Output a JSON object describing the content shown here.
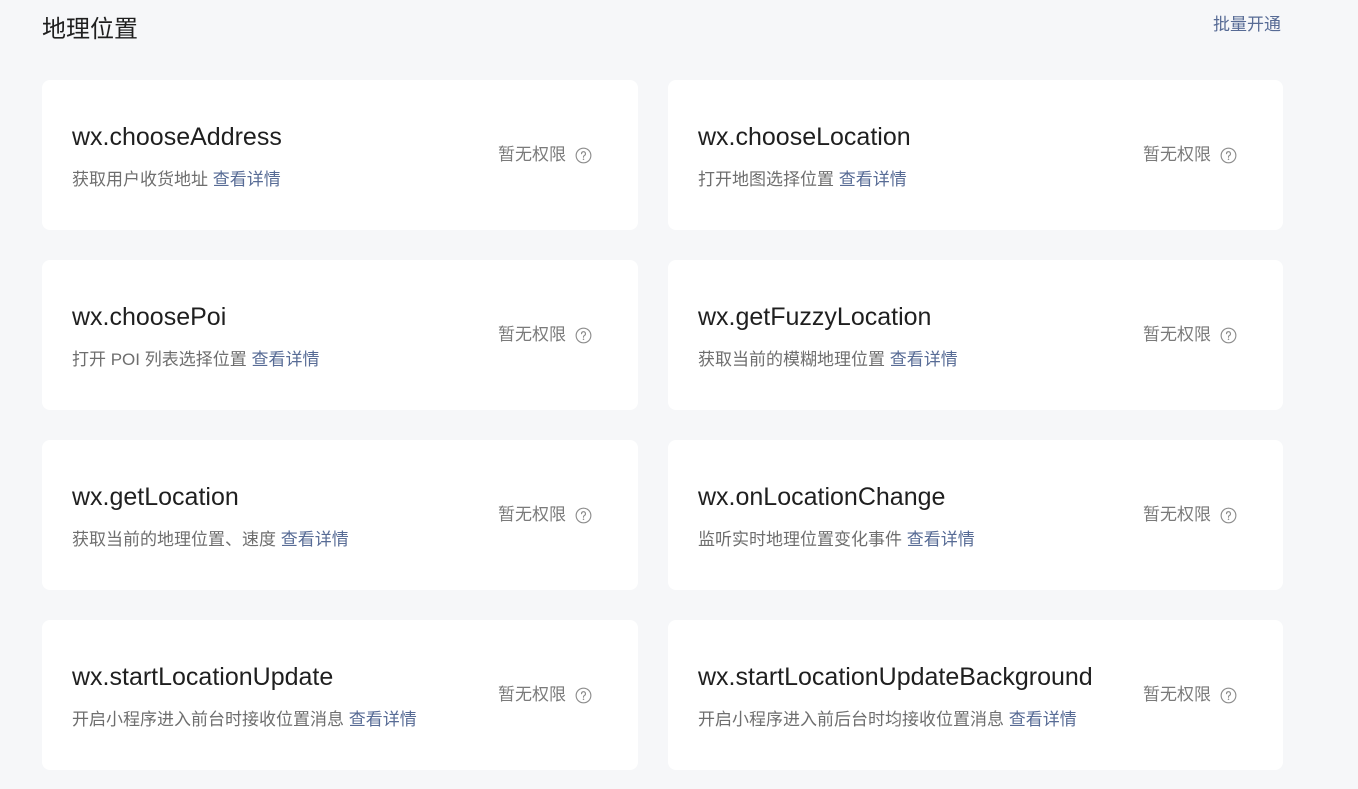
{
  "section": {
    "title": "地理位置",
    "batch_label": "批量开通"
  },
  "cards": [
    {
      "name": "wx.chooseAddress",
      "desc": "获取用户收货地址",
      "link": "查看详情",
      "status": "暂无权限",
      "help_icon": "question-circle-icon"
    },
    {
      "name": "wx.chooseLocation",
      "desc": "打开地图选择位置",
      "link": "查看详情",
      "status": "暂无权限",
      "help_icon": "question-circle-icon"
    },
    {
      "name": "wx.choosePoi",
      "desc": "打开 POI 列表选择位置",
      "link": "查看详情",
      "status": "暂无权限",
      "help_icon": "question-circle-icon"
    },
    {
      "name": "wx.getFuzzyLocation",
      "desc": "获取当前的模糊地理位置",
      "link": "查看详情",
      "status": "暂无权限",
      "help_icon": "question-circle-icon"
    },
    {
      "name": "wx.getLocation",
      "desc": "获取当前的地理位置、速度",
      "link": "查看详情",
      "status": "暂无权限",
      "help_icon": "question-circle-icon"
    },
    {
      "name": "wx.onLocationChange",
      "desc": "监听实时地理位置变化事件",
      "link": "查看详情",
      "status": "暂无权限",
      "help_icon": "question-circle-icon"
    },
    {
      "name": "wx.startLocationUpdate",
      "desc": "开启小程序进入前台时接收位置消息",
      "link": "查看详情",
      "status": "暂无权限",
      "help_icon": "question-circle-icon"
    },
    {
      "name": "wx.startLocationUpdateBackground",
      "desc": "开启小程序进入前后台时均接收位置消息",
      "link": "查看详情",
      "status": "暂无权限",
      "help_icon": "question-circle-icon"
    }
  ],
  "colors": {
    "background": "#f6f7f9",
    "card": "#ffffff",
    "link": "#576b95",
    "title_text": "#1f1f1f",
    "secondary_text": "#6e6e6e",
    "status_text": "#7a7a7a"
  }
}
